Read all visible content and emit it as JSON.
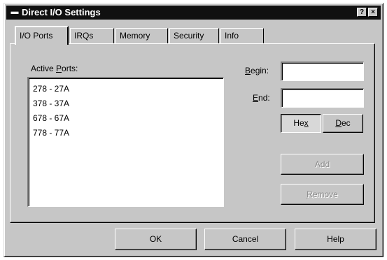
{
  "window": {
    "title": "Direct I/O Settings",
    "system_menu_icon": "dash-menu-icon",
    "help_button": "?",
    "close_button": "×"
  },
  "tabs": [
    {
      "label": "I/O Ports",
      "active": true
    },
    {
      "label": "IRQs",
      "active": false
    },
    {
      "label": "Memory",
      "active": false
    },
    {
      "label": "Security",
      "active": false
    },
    {
      "label": "Info",
      "active": false
    }
  ],
  "ports": {
    "active_ports_label_pre": "Active ",
    "active_ports_label_mnemonic": "P",
    "active_ports_label_post": "orts:",
    "items": [
      "278 - 27A",
      "378 - 37A",
      "678 - 67A",
      "778 - 77A"
    ]
  },
  "range": {
    "begin_label_mnemonic": "B",
    "begin_label_post": "egin:",
    "begin_value": "",
    "end_label_mnemonic": "E",
    "end_label_post": "nd:",
    "end_value": ""
  },
  "radix": {
    "hex_pre": "He",
    "hex_mnemonic": "x",
    "dec_mnemonic": "D",
    "dec_post": "ec",
    "selected": "Hex"
  },
  "actions": {
    "add_label": "Add",
    "remove_mnemonic": "R",
    "remove_post": "emove"
  },
  "footer": {
    "ok_label": "OK",
    "cancel_label": "Cancel",
    "help_label": "Help"
  },
  "colors": {
    "face": "#c6c6c6",
    "titlebar": "#101010",
    "disabled_text": "#8a8a8a"
  }
}
